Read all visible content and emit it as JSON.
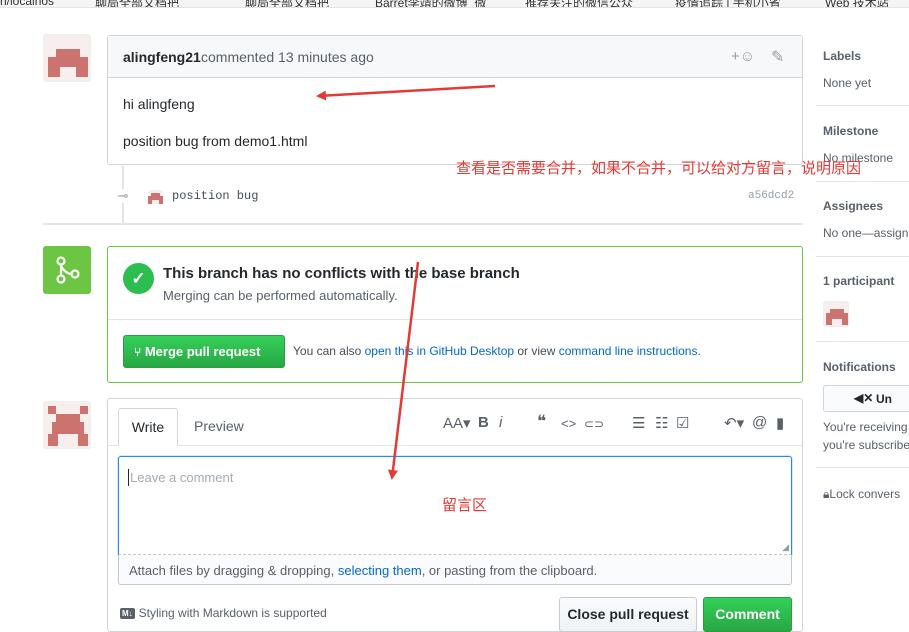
{
  "bookmarks": [
    "h/localhos",
    "聊局全部文档把",
    "聊局全部文档把",
    "Barret李靖的微博_微",
    "推荐关注的微信公众",
    "疫情追踪 | 手机小省",
    "Web 技术站"
  ],
  "comment": {
    "author": "alingfeng21",
    "meta": "commented 13 minutes ago",
    "react_icon": "+☺",
    "edit_icon": "✎",
    "lines": [
      "hi alingfeng",
      "position bug from demo1.html"
    ]
  },
  "commit": {
    "message": "position bug",
    "sha": "a56dcd2"
  },
  "merge": {
    "title": "This branch has no conflicts with the base branch",
    "subtitle": "Merging can be performed automatically.",
    "button": "Merge pull request",
    "info_prefix": "You can also ",
    "info_link1": "open this in GitHub Desktop",
    "info_middle": " or view ",
    "info_link2": "command line instructions",
    "info_suffix": "."
  },
  "editor": {
    "tab_write": "Write",
    "tab_preview": "Preview",
    "placeholder": "Leave a comment",
    "attach_prefix": "Attach files by dragging & dropping, ",
    "attach_link": "selecting them",
    "attach_suffix": ", or pasting from the clipboard.",
    "markdown_badge": "M↓",
    "markdown_note": "Styling with Markdown is supported",
    "close_button": "Close pull request",
    "comment_button": "Comment",
    "toolbar": {
      "header": "AA▾",
      "bold": "B",
      "italic": "i",
      "quote": "❝",
      "code": "<>",
      "link": "⊂⊃",
      "ul": "☰",
      "ol": "☷",
      "tasks": "☑",
      "reply": "↶▾",
      "mention": "@",
      "saved": "▮"
    }
  },
  "sidebar": {
    "labels_title": "Labels",
    "labels_value": "None yet",
    "milestone_title": "Milestone",
    "milestone_value": "No milestone",
    "assignees_title": "Assignees",
    "assignees_value": "No one—assign",
    "participants_title": "1 participant",
    "notifications_title": "Notifications",
    "notif_button": "Un",
    "notif_line1": "You're receiving",
    "notif_line2": "you're subscribe",
    "lock_text": "Lock convers"
  },
  "annotations": {
    "merge_note": "查看是否需要合并，如果不合并，可以给对方留言，说明原因",
    "comment_area": "留言区"
  },
  "colors": {
    "merge_green": "#6cc644",
    "button_green": "#28a745",
    "annotation_red": "#e53935",
    "link_blue": "#0366d6"
  }
}
